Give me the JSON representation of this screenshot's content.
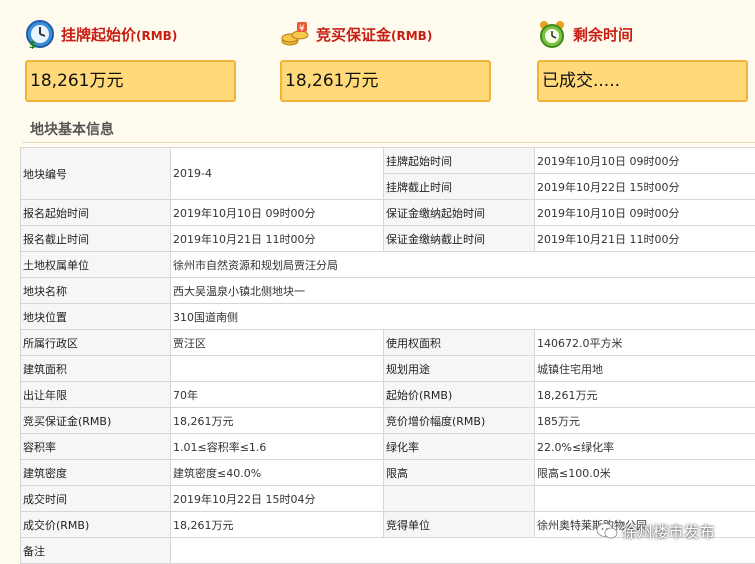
{
  "header": {
    "start_price": {
      "label": "挂牌起始价",
      "unit": "(RMB)",
      "value": "18,261万元"
    },
    "deposit": {
      "label": "竞买保证金",
      "unit": "(RMB)",
      "value": "18,261万元"
    },
    "remaining": {
      "label": "剩余时间",
      "value": "已成交....."
    }
  },
  "section_title": "地块基本信息",
  "table": {
    "r1": {
      "l1": "地块编号",
      "v1": "2019-4",
      "l2": "挂牌起始时间",
      "v2": "2019年10月10日 09时00分"
    },
    "r2": {
      "l2": "挂牌截止时间",
      "v2": "2019年10月22日 15时00分"
    },
    "r3": {
      "l1": "报名起始时间",
      "v1": "2019年10月10日 09时00分",
      "l2": "保证金缴纳起始时间",
      "v2": "2019年10月10日 09时00分"
    },
    "r4": {
      "l1": "报名截止时间",
      "v1": "2019年10月21日 11时00分",
      "l2": "保证金缴纳截止时间",
      "v2": "2019年10月21日 11时00分"
    },
    "r5": {
      "l1": "土地权属单位",
      "v1": "徐州市自然资源和规划局贾汪分局"
    },
    "r6": {
      "l1": "地块名称",
      "v1": "西大吴温泉小镇北侧地块一"
    },
    "r7": {
      "l1": "地块位置",
      "v1": "310国道南侧"
    },
    "r8": {
      "l1": "所属行政区",
      "v1": "贾汪区",
      "l2": "使用权面积",
      "v2": "140672.0平方米"
    },
    "r9": {
      "l1": "建筑面积",
      "v1": "",
      "l2": "规划用途",
      "v2": "城镇住宅用地"
    },
    "r10": {
      "l1": "出让年限",
      "v1": "70年",
      "l2": "起始价(RMB)",
      "v2": "18,261万元"
    },
    "r11": {
      "l1": "竞买保证金(RMB)",
      "v1": "18,261万元",
      "l2": "竞价增价幅度(RMB)",
      "v2": "185万元"
    },
    "r12": {
      "l1": "容积率",
      "v1": "1.01≤容积率≤1.6",
      "l2": "绿化率",
      "v2": "22.0%≤绿化率"
    },
    "r13": {
      "l1": "建筑密度",
      "v1": "建筑密度≤40.0%",
      "l2": "限高",
      "v2": "限高≤100.0米"
    },
    "r14": {
      "l1": "成交时间",
      "v1": "2019年10月22日 15时04分",
      "l2": "",
      "v2": ""
    },
    "r15": {
      "l1": "成交价(RMB)",
      "v1": "18,261万元",
      "l2": "竞得单位",
      "v2": "徐州奥特莱斯购物公园"
    },
    "r16": {
      "l1": "备注",
      "v1": ""
    }
  },
  "watermark": "徐州楼市发布"
}
